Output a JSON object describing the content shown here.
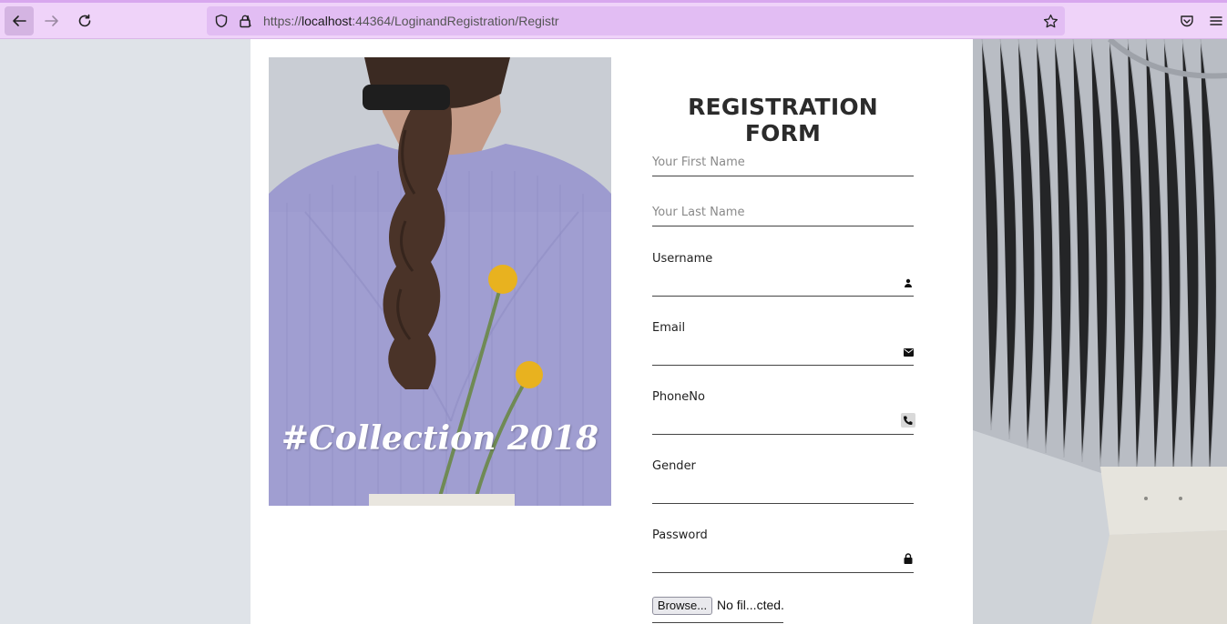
{
  "browser": {
    "url_scheme_host_prefix": "https://",
    "url_host": "localhost",
    "url_rest": ":44364/LoginandRegistration/Registr",
    "icons": {
      "back": "arrow-left-icon",
      "forward": "arrow-right-icon",
      "reload": "reload-icon",
      "shield": "tracking-shield-icon",
      "lock": "lock-icon",
      "bookmark": "star-icon",
      "pocket": "pocket-icon",
      "menu": "hamburger-menu-icon"
    },
    "colors": {
      "toolbar": "#efd3f9",
      "urlbar": "#e2bdf3"
    }
  },
  "promo": {
    "caption": "#Collection 2018"
  },
  "form": {
    "title": "REGISTRATION FORM",
    "first_name_placeholder": "Your First Name",
    "last_name_placeholder": "Your Last Name",
    "username_label": "Username",
    "email_label": "Email",
    "phone_label": "PhoneNo",
    "gender_label": "Gender",
    "password_label": "Password",
    "file_button": "Browse...",
    "file_status": "No fil...cted.",
    "icons": {
      "username": "person-icon",
      "email": "envelope-icon",
      "phone": "phone-icon",
      "password": "lock-icon"
    }
  }
}
